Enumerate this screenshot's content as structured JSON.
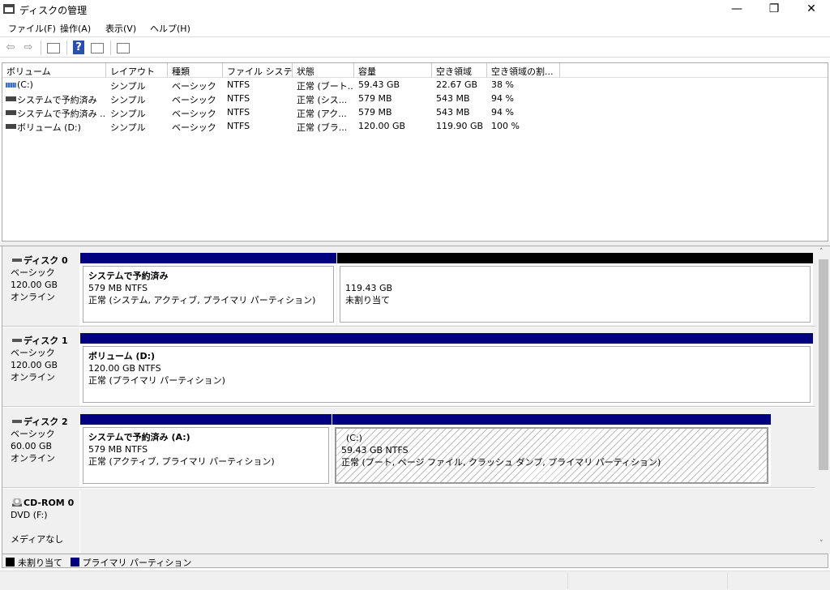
{
  "window": {
    "title": "ディスクの管理",
    "minimize": "—",
    "maximize": "❐",
    "close": "✕"
  },
  "menu": [
    "ファイル(F)",
    "操作(A)",
    "表示(V)",
    "ヘルプ(H)"
  ],
  "toolbar": {
    "back": "⇦",
    "forward": "⇨",
    "help": "?"
  },
  "columns": [
    "ボリューム",
    "レイアウト",
    "種類",
    "ファイル システム",
    "状態",
    "容量",
    "空き領域",
    "空き領域の割..."
  ],
  "volumes": [
    [
      "(C:)",
      "シンプル",
      "ベーシック",
      "NTFS",
      "正常 (ブート...",
      "59.43 GB",
      "22.67 GB",
      "38 %"
    ],
    [
      "システムで予約済み",
      "シンプル",
      "ベーシック",
      "NTFS",
      "正常 (シス...",
      "579 MB",
      "543 MB",
      "94 %"
    ],
    [
      "システムで予約済み ...",
      "シンプル",
      "ベーシック",
      "NTFS",
      "正常 (アク...",
      "579 MB",
      "543 MB",
      "94 %"
    ],
    [
      "ボリューム (D:)",
      "シンプル",
      "ベーシック",
      "NTFS",
      "正常 (ブラ...",
      "120.00 GB",
      "119.90 GB",
      "100 %"
    ]
  ],
  "disks": [
    {
      "name": "ディスク 0",
      "type": "ベーシック",
      "size": "120.00 GB",
      "status": "オンライン",
      "partitions": [
        {
          "title": "システムで予約済み",
          "size": "579 MB NTFS",
          "status": "正常 (システム, アクティブ, プライマリ パーティション)"
        },
        {
          "title": "",
          "size": "119.43 GB",
          "status": "未割り当て"
        }
      ]
    },
    {
      "name": "ディスク 1",
      "type": "ベーシック",
      "size": "120.00 GB",
      "status": "オンライン",
      "partitions": [
        {
          "title": "ボリューム  (D:)",
          "size": "120.00 GB NTFS",
          "status": "正常 (プライマリ パーティション)"
        }
      ]
    },
    {
      "name": "ディスク 2",
      "type": "ベーシック",
      "size": "60.00 GB",
      "status": "オンライン",
      "partitions": [
        {
          "title": "システムで予約済み  (A:)",
          "size": "579 MB NTFS",
          "status": "正常 (アクティブ, プライマリ パーティション)"
        },
        {
          "title": "(C:)",
          "size": "59.43 GB NTFS",
          "status": "正常 (ブート, ページ ファイル, クラッシュ ダンプ, プライマリ パーティション)"
        }
      ]
    }
  ],
  "cdrom": {
    "name": "CD-ROM 0",
    "type": "DVD (F:)",
    "status": "メディアなし"
  },
  "legend": {
    "unallocated": "未割り当て",
    "primary": "プライマリ パーティション"
  },
  "colors": {
    "primary": "#000080",
    "unallocated": "#000000",
    "selection": "#0078d7"
  }
}
